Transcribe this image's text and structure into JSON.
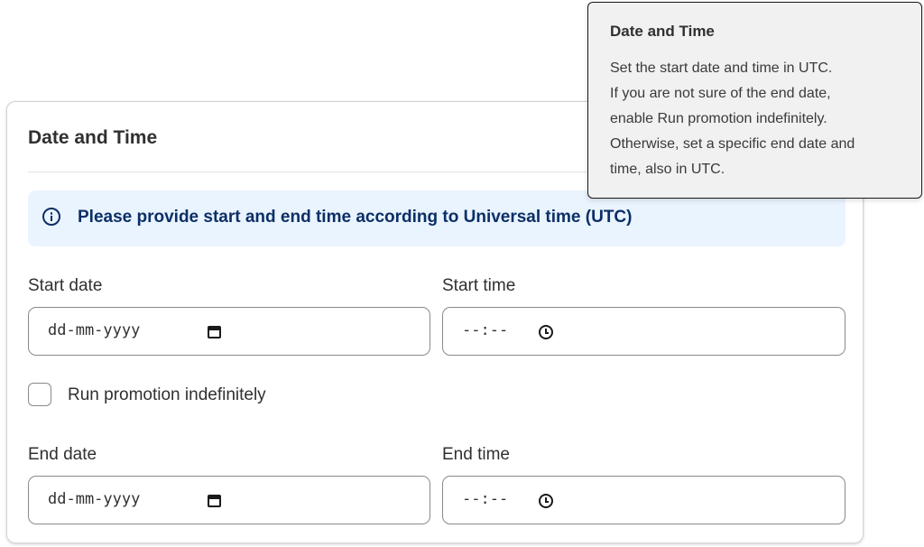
{
  "card": {
    "title": "Date and Time",
    "banner": {
      "icon": "info-circle-icon",
      "text": "Please provide start and end time according to Universal time (UTC)",
      "background": "#eaf4ff",
      "text_color": "#0b2f66"
    },
    "start_date": {
      "label": "Start date",
      "value": "dd-mm-yyyy",
      "icon": "calendar-icon"
    },
    "start_time": {
      "label": "Start time",
      "value": "--:--",
      "icon": "clock-icon"
    },
    "run_indefinitely": {
      "label": "Run promotion indefinitely",
      "checked": false
    },
    "end_date": {
      "label": "End date",
      "value": "dd-mm-yyyy",
      "icon": "calendar-icon"
    },
    "end_time": {
      "label": "End time",
      "value": "--:--",
      "icon": "clock-icon"
    }
  },
  "tooltip": {
    "title": "Date and Time",
    "lines": [
      "Set the start date and time in UTC.",
      "If you are not sure of the end date,",
      "enable Run promotion indefinitely.",
      "Otherwise, set a specific end date and",
      "time, also in UTC."
    ]
  }
}
